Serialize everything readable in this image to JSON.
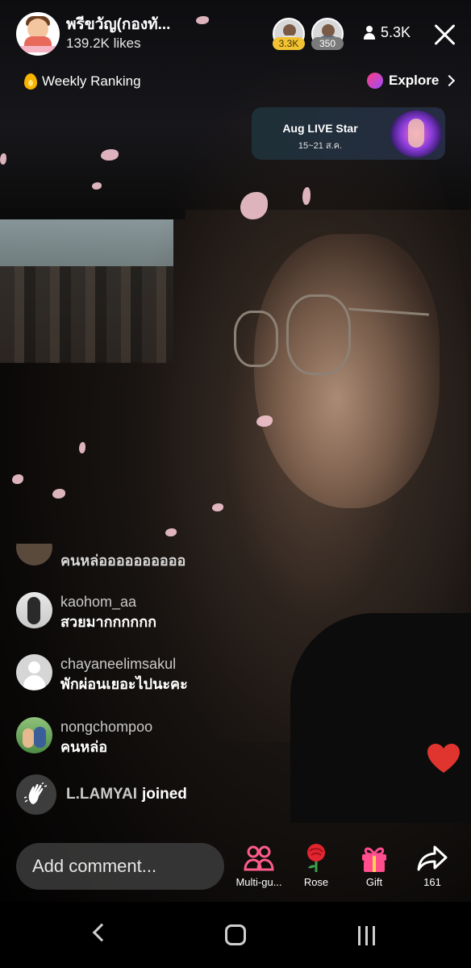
{
  "host": {
    "name": "พรีขวัญ(กองทั...",
    "likes": "139.2K likes"
  },
  "top_viewers": [
    {
      "badge": "3.3K",
      "badge_color": "#f1c232"
    },
    {
      "badge": "350",
      "badge_color": "#7a7a7a"
    }
  ],
  "viewer_count": "5.3K",
  "ranking": {
    "label": "Weekly Ranking",
    "icon": "flame-icon"
  },
  "explore": {
    "label": "Explore",
    "icon": "explore-icon"
  },
  "promo": {
    "title": "Aug LIVE Star",
    "date": "15~21 ส.ค."
  },
  "comments": [
    {
      "user": "",
      "message": "คนหล่ออออออออออ"
    },
    {
      "user": "kaohom_aa",
      "message": "สวยมากกกกกก"
    },
    {
      "user": "chayaneelimsakul",
      "message": "พักผ่อนเยอะไปนะคะ"
    },
    {
      "user": "nongchompoo",
      "message": "คนหล่อ"
    }
  ],
  "join_event": {
    "user": "L.LAMYAI",
    "text": "joined"
  },
  "comment_input": {
    "placeholder": "Add comment..."
  },
  "actions": {
    "multi_guest": "Multi-gu...",
    "rose": "Rose",
    "gift": "Gift",
    "share_count": "161"
  },
  "colors": {
    "heart": "#e0342f",
    "explore_gradient_start": "#ff3d7f",
    "explore_gradient_end": "#9b4dff",
    "gift": "#ff4d8d"
  }
}
